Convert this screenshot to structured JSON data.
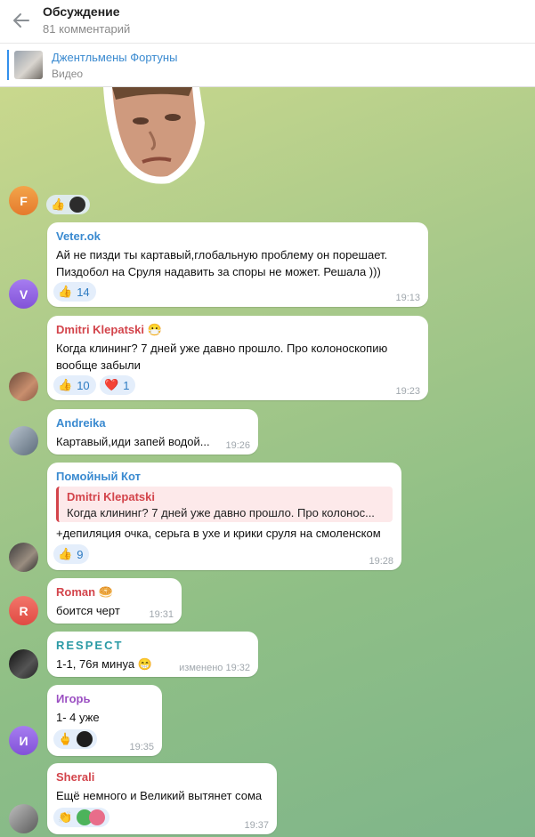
{
  "header": {
    "title": "Обсуждение",
    "subtitle": "81 комментарий"
  },
  "pinned": {
    "title": "Джентльмены Фортуны",
    "subtitle": "Видео"
  },
  "colors": {
    "accent": "#3390ec",
    "reaction_bg": "#e4eefb",
    "reaction_text": "#2d7bc2"
  },
  "messages": [
    {
      "id": "m0",
      "avatar_letter": "F",
      "reaction": "👍"
    },
    {
      "id": "m1",
      "author": "Veter.ok",
      "author_color": "#3a8ad0",
      "avatar_letter": "V",
      "lines": [
        "Ай не пизди ты картавый,глобальную проблему он порешает.",
        "Пиздобол на Сруля надавить за споры не может. Решала )))"
      ],
      "reactions": [
        {
          "emoji": "👍",
          "count": "14"
        }
      ],
      "time": "19:13"
    },
    {
      "id": "m2",
      "author": "Dmitri Klepatski",
      "author_emoji": "😷",
      "author_color": "#d3444b",
      "lines": [
        "Когда клининг? 7 дней уже давно прошло. Про колоноскопию",
        "вообще забыли"
      ],
      "reactions": [
        {
          "emoji": "👍",
          "count": "10"
        },
        {
          "emoji": "❤️",
          "count": "1"
        }
      ],
      "time": "19:23"
    },
    {
      "id": "m3",
      "author": "Andreika",
      "author_color": "#3a8ad0",
      "lines": [
        "Картавый,иди запей водой..."
      ],
      "time": "19:26"
    },
    {
      "id": "m4",
      "author": "Помойный Кот",
      "author_color": "#3a8ad0",
      "quote": {
        "author": "Dmitri Klepatski",
        "text": "Когда клининг? 7 дней уже давно прошло. Про колонос..."
      },
      "lines": [
        "+депиляция очка, серьга в ухе и крики сруля на смоленском"
      ],
      "reactions": [
        {
          "emoji": "👍",
          "count": "9"
        }
      ],
      "time": "19:28"
    },
    {
      "id": "m5",
      "author": "Roman",
      "author_emoji": "🥯",
      "author_color": "#d3444b",
      "avatar_letter": "R",
      "lines": [
        "боится черт"
      ],
      "time": "19:31"
    },
    {
      "id": "m6",
      "author": "RESPECT",
      "author_color": "#2a9aa5",
      "lines": [
        "1-1, 76я минуа 😁"
      ],
      "time": "изменено 19:32"
    },
    {
      "id": "m7",
      "author": "Игорь",
      "author_color": "#9b4fc2",
      "avatar_letter": "И",
      "lines": [
        "1- 4 уже"
      ],
      "reaction": "🖕",
      "time": "19:35"
    },
    {
      "id": "m8",
      "author": "Sherali",
      "author_color": "#d3444b",
      "lines": [
        "Ещё немного и Великий вытянет сома"
      ],
      "reaction": "👏",
      "time": "19:37"
    }
  ]
}
